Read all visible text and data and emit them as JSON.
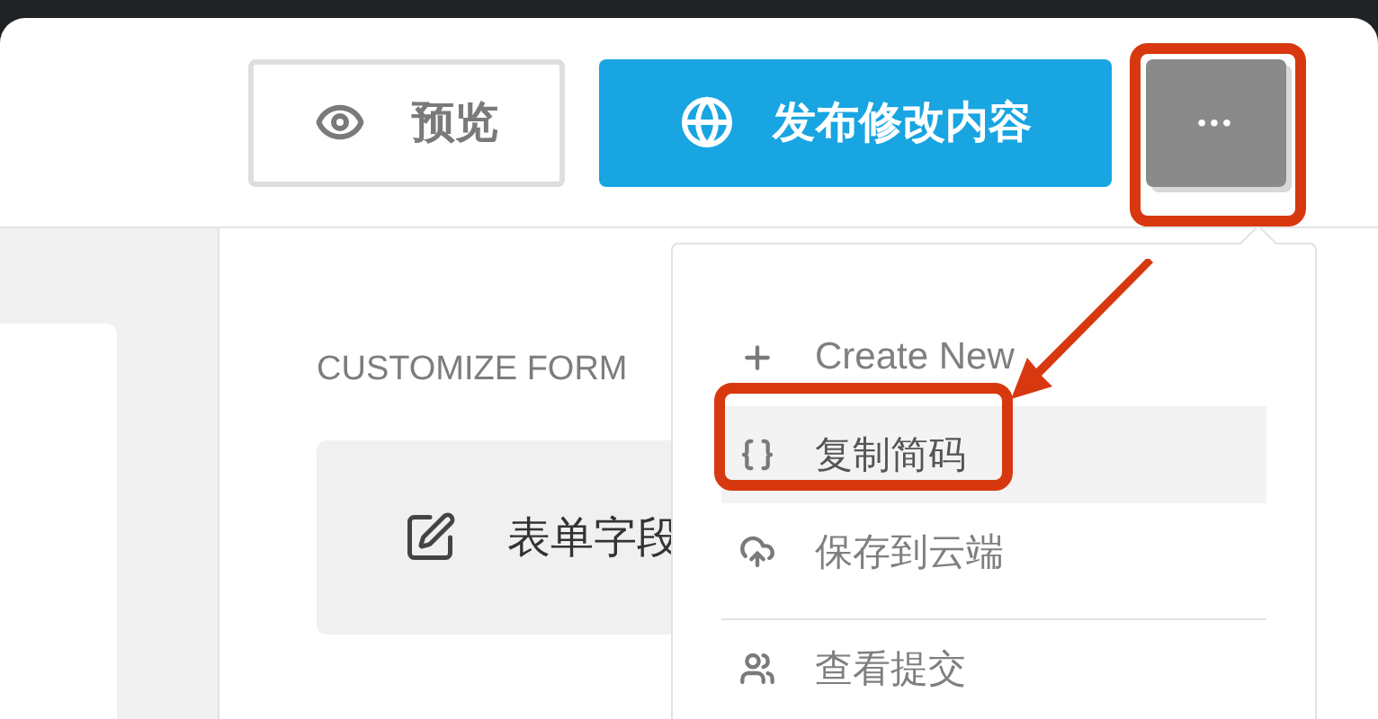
{
  "header": {
    "preview_button": "预览",
    "publish_button": "发布修改内容",
    "more_button": "•••"
  },
  "panel": {
    "section_title": "CUSTOMIZE FORM",
    "card_label": "表单字段"
  },
  "menu": {
    "items": [
      {
        "label": "Create New",
        "selected": false,
        "divider_before": false
      },
      {
        "label": "复制简码",
        "selected": true,
        "divider_before": false
      },
      {
        "label": "保存到云端",
        "selected": false,
        "divider_before": false
      },
      {
        "label": "查看提交",
        "selected": false,
        "divider_before": true
      }
    ]
  }
}
